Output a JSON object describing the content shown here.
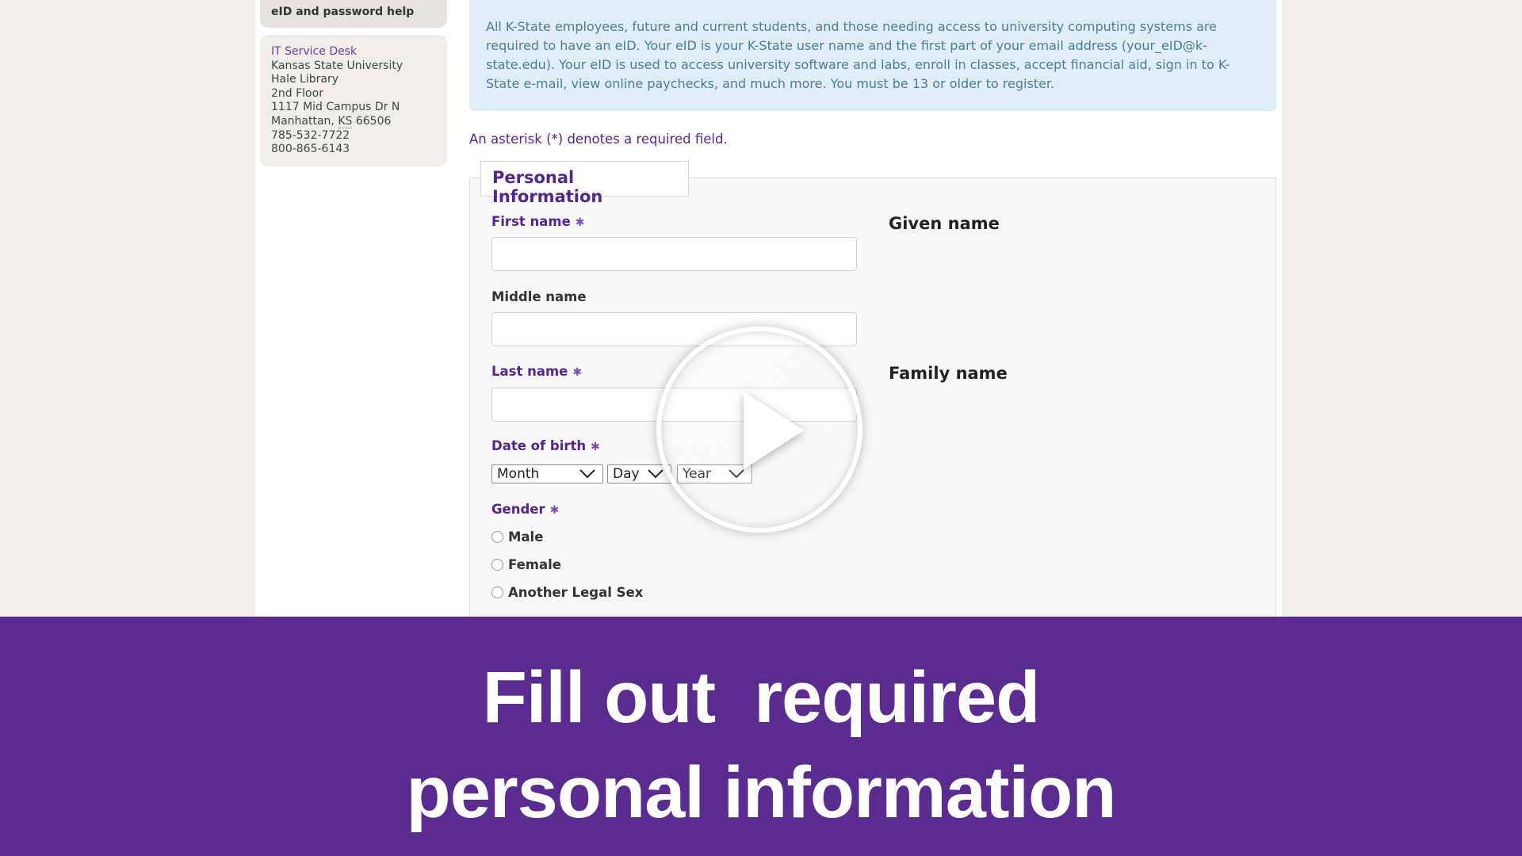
{
  "sidebar": {
    "help_label": "eID and password help",
    "contact": {
      "link": "IT Service Desk",
      "lines": [
        "Kansas State University",
        "Hale Library",
        "2nd Floor",
        "1117 Mid Campus Dr N"
      ],
      "city": "Manhattan, ",
      "state": "KS",
      "zip": " 66506",
      "phones": [
        "785-532-7722",
        "800-865-6143"
      ]
    }
  },
  "info": {
    "text": "All K-State employees, future and current students, and those needing access to university computing systems are required to have an eID. Your eID is your K-State user name and the first part of your email address (your_eID@k-state.edu). Your eID is used to access university software and labs, enroll in classes, accept financial aid, sign in to K-State e-mail, view online paychecks, and much more. You must be 13 or older to register."
  },
  "required_note": "An asterisk (*) denotes a required field.",
  "form": {
    "legend": "Personal Information",
    "required_marker": "✱",
    "first_name": {
      "label": "First name",
      "value": "",
      "hint": "Given name"
    },
    "middle_name": {
      "label": "Middle name",
      "value": ""
    },
    "last_name": {
      "label": "Last name",
      "value": "",
      "hint": "Family name"
    },
    "dob": {
      "label": "Date of birth",
      "month": "Month",
      "day": "Day",
      "year": "Year"
    },
    "gender": {
      "label": "Gender",
      "options": [
        "Male",
        "Female",
        "Another Legal Sex"
      ]
    }
  },
  "video": {
    "play_icon": "play-icon"
  },
  "banner": {
    "line1": "Fill out  required",
    "line2": "personal information",
    "color": "#5b2c8f"
  },
  "colors": {
    "accent": "#512888",
    "info_bg": "#dfeef7",
    "info_text": "#4a7d98"
  }
}
